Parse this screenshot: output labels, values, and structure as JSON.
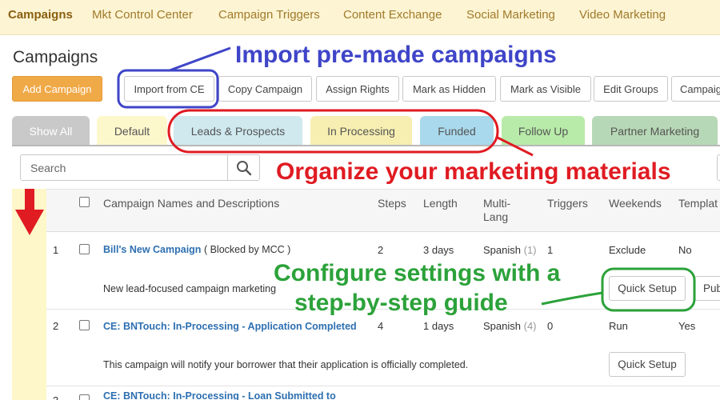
{
  "nav": {
    "items": [
      "Campaigns",
      "Mkt Control Center",
      "Campaign Triggers",
      "Content Exchange",
      "Social Marketing",
      "Video Marketing"
    ],
    "active": "Campaigns"
  },
  "page": {
    "title": "Campaigns"
  },
  "toolbar": {
    "add_campaign": "Add Campaign",
    "import_from_ce": "Import from CE",
    "copy_campaign": "Copy Campaign",
    "assign_rights": "Assign Rights",
    "mark_hidden": "Mark as Hidden",
    "mark_visible": "Mark as Visible",
    "edit_groups": "Edit Groups",
    "campaign_partial": "Campaig"
  },
  "tabs": [
    {
      "label": "Show All",
      "bg": "#c9c9c9",
      "color": "#ffffff"
    },
    {
      "label": "Default",
      "bg": "#fdf7cc",
      "color": "#555555"
    },
    {
      "label": "Leads & Prospects",
      "bg": "#cfe9ef",
      "color": "#555555"
    },
    {
      "label": "In Processing",
      "bg": "#f6efb1",
      "color": "#555555"
    },
    {
      "label": "Funded",
      "bg": "#a9d9ec",
      "color": "#555555"
    },
    {
      "label": "Follow Up",
      "bg": "#b8eba9",
      "color": "#555555"
    },
    {
      "label": "Partner Marketing",
      "bg": "#b7d8b6",
      "color": "#555555"
    }
  ],
  "search": {
    "placeholder": "Search"
  },
  "table": {
    "headers": {
      "name": "Campaign Names and Descriptions",
      "steps": "Steps",
      "length": "Length",
      "multi_lang_1": "Multi-",
      "multi_lang_2": "Lang",
      "triggers": "Triggers",
      "weekends": "Weekends",
      "template": "Templat"
    },
    "rows": [
      {
        "num": "1",
        "name": "Bill's New Campaign",
        "note": "( Blocked by MCC )",
        "steps": "2",
        "length": "3 days",
        "lang": "Spanish",
        "lang_count": "(1)",
        "triggers": "1",
        "weekends": "Exclude",
        "template": "No",
        "description": "New lead-focused campaign marketing",
        "action": "Quick Setup",
        "action2": "Pub"
      },
      {
        "num": "2",
        "name": "CE: BNTouch: In-Processing - Application Completed",
        "steps": "4",
        "length": "1 days",
        "lang": "Spanish",
        "lang_count": "(4)",
        "triggers": "0",
        "weekends": "Run",
        "template": "Yes",
        "description": "This campaign will notify your borrower that their application is officially completed.",
        "action": "Quick Setup"
      },
      {
        "num": "3",
        "name": "CE: BNTouch: In-Processing - Loan Submitted to"
      }
    ]
  },
  "annotations": {
    "import": "Import pre-made campaigns",
    "organize": "Organize your marketing materials",
    "configure_1": "Configure settings with a",
    "configure_2": "step-by-step guide"
  },
  "colors": {
    "annotation_blue": "#3f45c8",
    "annotation_red": "#e01b22",
    "annotation_green": "#2ca23a",
    "link_blue": "#2d6fb1",
    "accent_orange": "#f0a947"
  }
}
